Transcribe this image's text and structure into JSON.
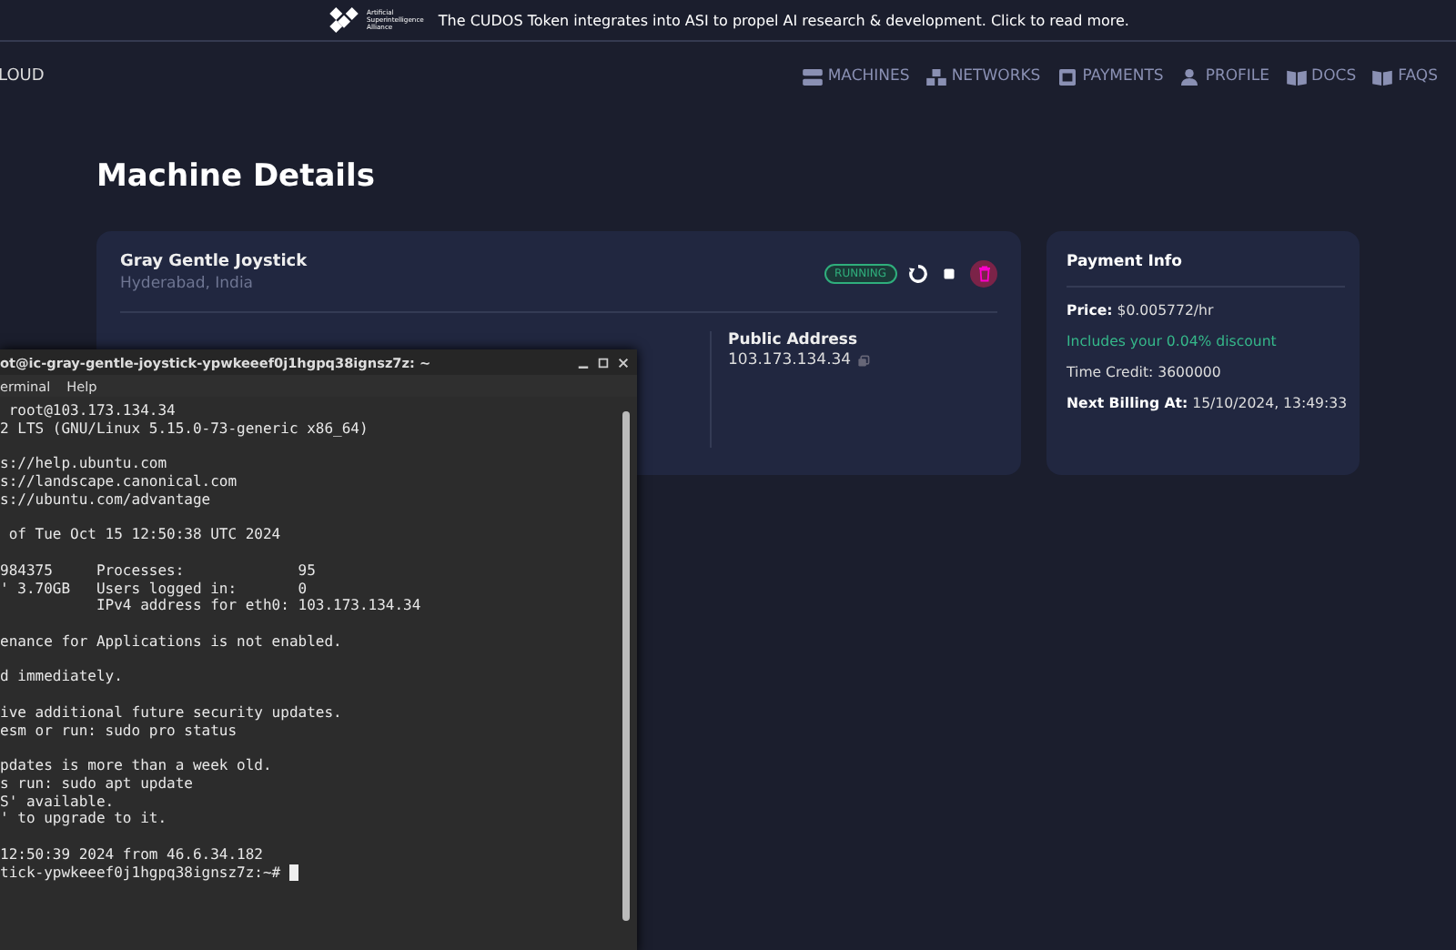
{
  "banner": {
    "logo_lines": [
      "Artificial",
      "Superintelligence",
      "Alliance"
    ],
    "message": "The CUDOS Token integrates into ASI to propel AI research & development. Click to read more."
  },
  "nav": {
    "brand": "LOUD",
    "items": [
      {
        "label": "MACHINES"
      },
      {
        "label": "NETWORKS"
      },
      {
        "label": "PAYMENTS"
      },
      {
        "label": "PROFILE"
      },
      {
        "label": "DOCS"
      },
      {
        "label": "FAQS"
      }
    ]
  },
  "page_title": "Machine Details",
  "machine": {
    "name": "Gray Gentle Joystick",
    "location": "Hyderabad, India",
    "status": "RUNNING",
    "public_address": {
      "label": "Public Address",
      "value": "103.173.134.34"
    }
  },
  "payment": {
    "title": "Payment Info",
    "rows": [
      {
        "kind": "field",
        "label": "Price:",
        "value": "$0.005772/hr"
      },
      {
        "kind": "note",
        "value": "Includes your 0.04% discount"
      },
      {
        "kind": "plain",
        "value": "Time Credit: 3600000"
      },
      {
        "kind": "field",
        "label": "Next Billing At:",
        "value": "15/10/2024, 13:49:33"
      }
    ]
  },
  "terminal": {
    "title": "ot@ic-gray-gentle-joystick-ypwkeeef0j1hgpq38ignsz7z: ~",
    "menu": [
      "erminal",
      "Help"
    ],
    "blocks": [
      [
        " root@103.173.134.34",
        "2 LTS (GNU/Linux 5.15.0-73-generic x86_64)"
      ],
      [
        "s://help.ubuntu.com",
        "s://landscape.canonical.com",
        "s://ubuntu.com/advantage"
      ],
      [
        " of Tue Oct 15 12:50:38 UTC 2024"
      ],
      [
        "984375     Processes:             95",
        "' 3.70GB   Users logged in:       0",
        "           IPv4 address for eth0: 103.173.134.34"
      ],
      [
        "enance for Applications is not enabled."
      ],
      [
        "d immediately."
      ],
      [
        "ive additional future security updates.",
        "esm or run: sudo pro status"
      ],
      [
        "pdates is more than a week old.",
        "s run: sudo apt update",
        "S' available.",
        "' to upgrade to it."
      ],
      [
        "12:50:39 2024 from 46.6.34.182",
        "tick-ypwkeeef0j1hgpq38ignsz7z:~#"
      ]
    ]
  }
}
